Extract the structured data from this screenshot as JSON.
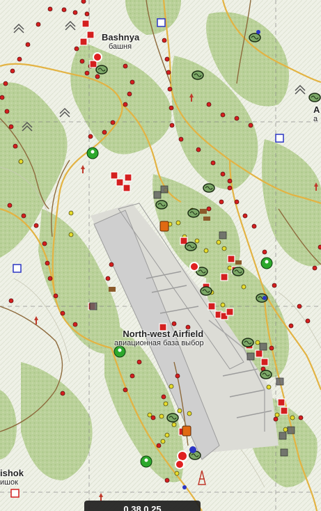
{
  "map": {
    "places": [
      {
        "id": "bashnya",
        "name": "Bashnya",
        "name_ru": "башня"
      },
      {
        "id": "airfield",
        "name": "North-west Airfield",
        "name_ru": "авиационная база выбор"
      },
      {
        "id": "edge-right",
        "name": "A",
        "name_ru": "а"
      },
      {
        "id": "edge-left",
        "name": "ishok",
        "name_ru": "ишок"
      }
    ],
    "coordinates": "0.38 0.25",
    "colors": {
      "terrain": "#e9ecdf",
      "forest": "#b7cf95",
      "road_main": "#e3b343",
      "road_minor": "#8d6a3c",
      "airfield": "#d6d6d6",
      "loot_red": "#d41f1f",
      "loot_yellow": "#e6dc2c",
      "animal_green": "#2ca82c",
      "vehicle_orange": "#e06a12",
      "police_blue": "#2b35c4"
    },
    "icons": [
      "tent-icon",
      "tree-icon",
      "brain-icon",
      "player-icon",
      "police-icon",
      "zombie-icon",
      "vehicle-icon",
      "helicrash-icon"
    ]
  }
}
